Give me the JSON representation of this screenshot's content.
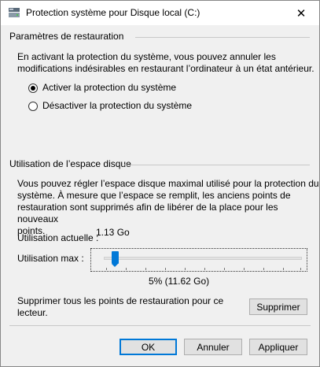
{
  "window": {
    "title": "Protection système pour Disque local (C:)",
    "close_glyph": "✕"
  },
  "restore_settings": {
    "heading": "Paramètres de restauration",
    "description_line1": "En activant la protection du système, vous pouvez annuler les",
    "description_line2": "modifications indésirables en restaurant l’ordinateur à un état antérieur.",
    "options": [
      {
        "label": "Activer la protection du système",
        "checked": true
      },
      {
        "label": "Désactiver la protection du système",
        "checked": false
      }
    ]
  },
  "disk_usage": {
    "heading": "Utilisation de l’espace disque",
    "description_line1": "Vous pouvez régler l’espace disque maximal utilisé pour la protection du",
    "description_line2": "système. À mesure que l’espace se remplit, les anciens points de",
    "description_line3": "restauration sont supprimés afin de libérer de la place pour les nouveaux",
    "description_line4": "points.",
    "current_label": "Utilisation actuelle :",
    "current_value": "1.13 Go",
    "max_label": "Utilisation max :",
    "max_value_text": "5% (11.62 Go)",
    "max_percent": 5
  },
  "delete": {
    "text_line1": "Supprimer tous les points de restauration pour ce",
    "text_line2": "lecteur.",
    "button_label": "Supprimer"
  },
  "footer": {
    "ok_label": "OK",
    "cancel_label": "Annuler",
    "apply_label": "Appliquer"
  }
}
